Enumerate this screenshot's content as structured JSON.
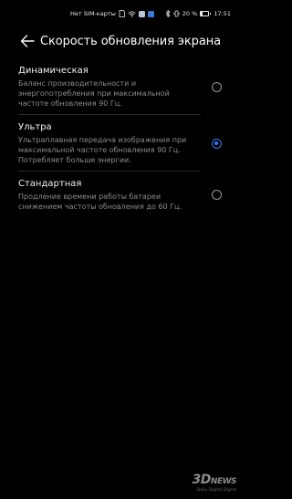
{
  "status_bar": {
    "carrier": "Нет SIM-карты",
    "battery_percent": "20 %",
    "battery_level": 0.2,
    "time": "17:51"
  },
  "header": {
    "title": "Скорость обновления экрана",
    "back_icon": "arrow-left-icon"
  },
  "options": [
    {
      "title": "Динамическая",
      "description": "Баланс производительности и энергопотребления при максимальной частоте обновления 90 Гц.",
      "selected": false
    },
    {
      "title": "Ультра",
      "description": "Ультраплавная передача изображения при максимальной частоте обновления 90 Гц. Потребляет больше энергии.",
      "selected": true
    },
    {
      "title": "Стандартная",
      "description": "Продление времени работы батареи снижением частоты обновления до 60 Гц.",
      "selected": false
    }
  ],
  "colors": {
    "accent": "#2f7cf6",
    "background": "#000000"
  },
  "watermark": {
    "logo": "3D",
    "logo_suffix": "NEWS",
    "tagline": "Daily Digital Digest"
  }
}
